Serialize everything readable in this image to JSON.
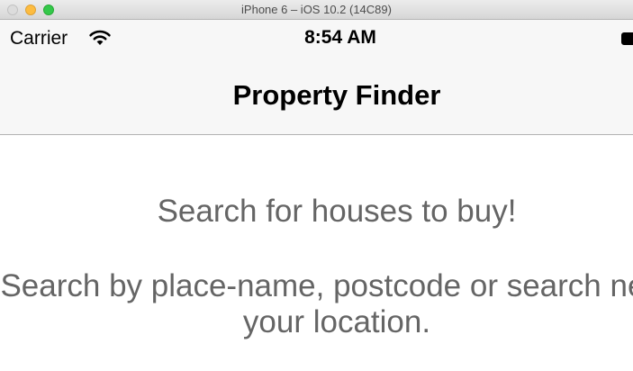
{
  "window": {
    "title": "iPhone 6 – iOS 10.2 (14C89)"
  },
  "status_bar": {
    "carrier": "Carrier",
    "time": "8:54 AM",
    "wifi_icon": "wifi-icon",
    "battery_icon": "battery-icon"
  },
  "nav_bar": {
    "title": "Property Finder"
  },
  "content": {
    "description_line1": "Search for houses to buy!",
    "description_line2": "Search by place-name, postcode or search near your location."
  },
  "colors": {
    "title_bar": "#dedede",
    "nav_background": "#f7f7f7",
    "description_text": "#656565",
    "traffic_close": "#dcdcdc",
    "traffic_minimize": "#fdbc40",
    "traffic_maximize": "#34c84a"
  }
}
